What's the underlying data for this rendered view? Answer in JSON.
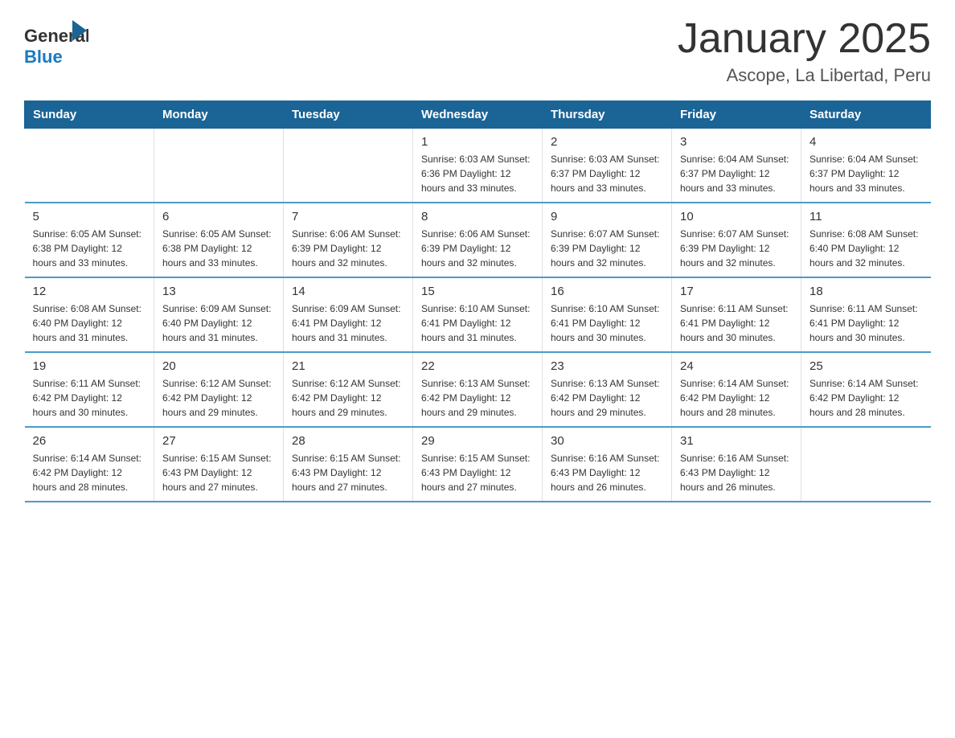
{
  "header": {
    "logo_general": "General",
    "logo_blue": "Blue",
    "title": "January 2025",
    "subtitle": "Ascope, La Libertad, Peru"
  },
  "calendar": {
    "days_of_week": [
      "Sunday",
      "Monday",
      "Tuesday",
      "Wednesday",
      "Thursday",
      "Friday",
      "Saturday"
    ],
    "weeks": [
      [
        {
          "day": "",
          "info": ""
        },
        {
          "day": "",
          "info": ""
        },
        {
          "day": "",
          "info": ""
        },
        {
          "day": "1",
          "info": "Sunrise: 6:03 AM\nSunset: 6:36 PM\nDaylight: 12 hours and 33 minutes."
        },
        {
          "day": "2",
          "info": "Sunrise: 6:03 AM\nSunset: 6:37 PM\nDaylight: 12 hours and 33 minutes."
        },
        {
          "day": "3",
          "info": "Sunrise: 6:04 AM\nSunset: 6:37 PM\nDaylight: 12 hours and 33 minutes."
        },
        {
          "day": "4",
          "info": "Sunrise: 6:04 AM\nSunset: 6:37 PM\nDaylight: 12 hours and 33 minutes."
        }
      ],
      [
        {
          "day": "5",
          "info": "Sunrise: 6:05 AM\nSunset: 6:38 PM\nDaylight: 12 hours and 33 minutes."
        },
        {
          "day": "6",
          "info": "Sunrise: 6:05 AM\nSunset: 6:38 PM\nDaylight: 12 hours and 33 minutes."
        },
        {
          "day": "7",
          "info": "Sunrise: 6:06 AM\nSunset: 6:39 PM\nDaylight: 12 hours and 32 minutes."
        },
        {
          "day": "8",
          "info": "Sunrise: 6:06 AM\nSunset: 6:39 PM\nDaylight: 12 hours and 32 minutes."
        },
        {
          "day": "9",
          "info": "Sunrise: 6:07 AM\nSunset: 6:39 PM\nDaylight: 12 hours and 32 minutes."
        },
        {
          "day": "10",
          "info": "Sunrise: 6:07 AM\nSunset: 6:39 PM\nDaylight: 12 hours and 32 minutes."
        },
        {
          "day": "11",
          "info": "Sunrise: 6:08 AM\nSunset: 6:40 PM\nDaylight: 12 hours and 32 minutes."
        }
      ],
      [
        {
          "day": "12",
          "info": "Sunrise: 6:08 AM\nSunset: 6:40 PM\nDaylight: 12 hours and 31 minutes."
        },
        {
          "day": "13",
          "info": "Sunrise: 6:09 AM\nSunset: 6:40 PM\nDaylight: 12 hours and 31 minutes."
        },
        {
          "day": "14",
          "info": "Sunrise: 6:09 AM\nSunset: 6:41 PM\nDaylight: 12 hours and 31 minutes."
        },
        {
          "day": "15",
          "info": "Sunrise: 6:10 AM\nSunset: 6:41 PM\nDaylight: 12 hours and 31 minutes."
        },
        {
          "day": "16",
          "info": "Sunrise: 6:10 AM\nSunset: 6:41 PM\nDaylight: 12 hours and 30 minutes."
        },
        {
          "day": "17",
          "info": "Sunrise: 6:11 AM\nSunset: 6:41 PM\nDaylight: 12 hours and 30 minutes."
        },
        {
          "day": "18",
          "info": "Sunrise: 6:11 AM\nSunset: 6:41 PM\nDaylight: 12 hours and 30 minutes."
        }
      ],
      [
        {
          "day": "19",
          "info": "Sunrise: 6:11 AM\nSunset: 6:42 PM\nDaylight: 12 hours and 30 minutes."
        },
        {
          "day": "20",
          "info": "Sunrise: 6:12 AM\nSunset: 6:42 PM\nDaylight: 12 hours and 29 minutes."
        },
        {
          "day": "21",
          "info": "Sunrise: 6:12 AM\nSunset: 6:42 PM\nDaylight: 12 hours and 29 minutes."
        },
        {
          "day": "22",
          "info": "Sunrise: 6:13 AM\nSunset: 6:42 PM\nDaylight: 12 hours and 29 minutes."
        },
        {
          "day": "23",
          "info": "Sunrise: 6:13 AM\nSunset: 6:42 PM\nDaylight: 12 hours and 29 minutes."
        },
        {
          "day": "24",
          "info": "Sunrise: 6:14 AM\nSunset: 6:42 PM\nDaylight: 12 hours and 28 minutes."
        },
        {
          "day": "25",
          "info": "Sunrise: 6:14 AM\nSunset: 6:42 PM\nDaylight: 12 hours and 28 minutes."
        }
      ],
      [
        {
          "day": "26",
          "info": "Sunrise: 6:14 AM\nSunset: 6:42 PM\nDaylight: 12 hours and 28 minutes."
        },
        {
          "day": "27",
          "info": "Sunrise: 6:15 AM\nSunset: 6:43 PM\nDaylight: 12 hours and 27 minutes."
        },
        {
          "day": "28",
          "info": "Sunrise: 6:15 AM\nSunset: 6:43 PM\nDaylight: 12 hours and 27 minutes."
        },
        {
          "day": "29",
          "info": "Sunrise: 6:15 AM\nSunset: 6:43 PM\nDaylight: 12 hours and 27 minutes."
        },
        {
          "day": "30",
          "info": "Sunrise: 6:16 AM\nSunset: 6:43 PM\nDaylight: 12 hours and 26 minutes."
        },
        {
          "day": "31",
          "info": "Sunrise: 6:16 AM\nSunset: 6:43 PM\nDaylight: 12 hours and 26 minutes."
        },
        {
          "day": "",
          "info": ""
        }
      ]
    ]
  }
}
